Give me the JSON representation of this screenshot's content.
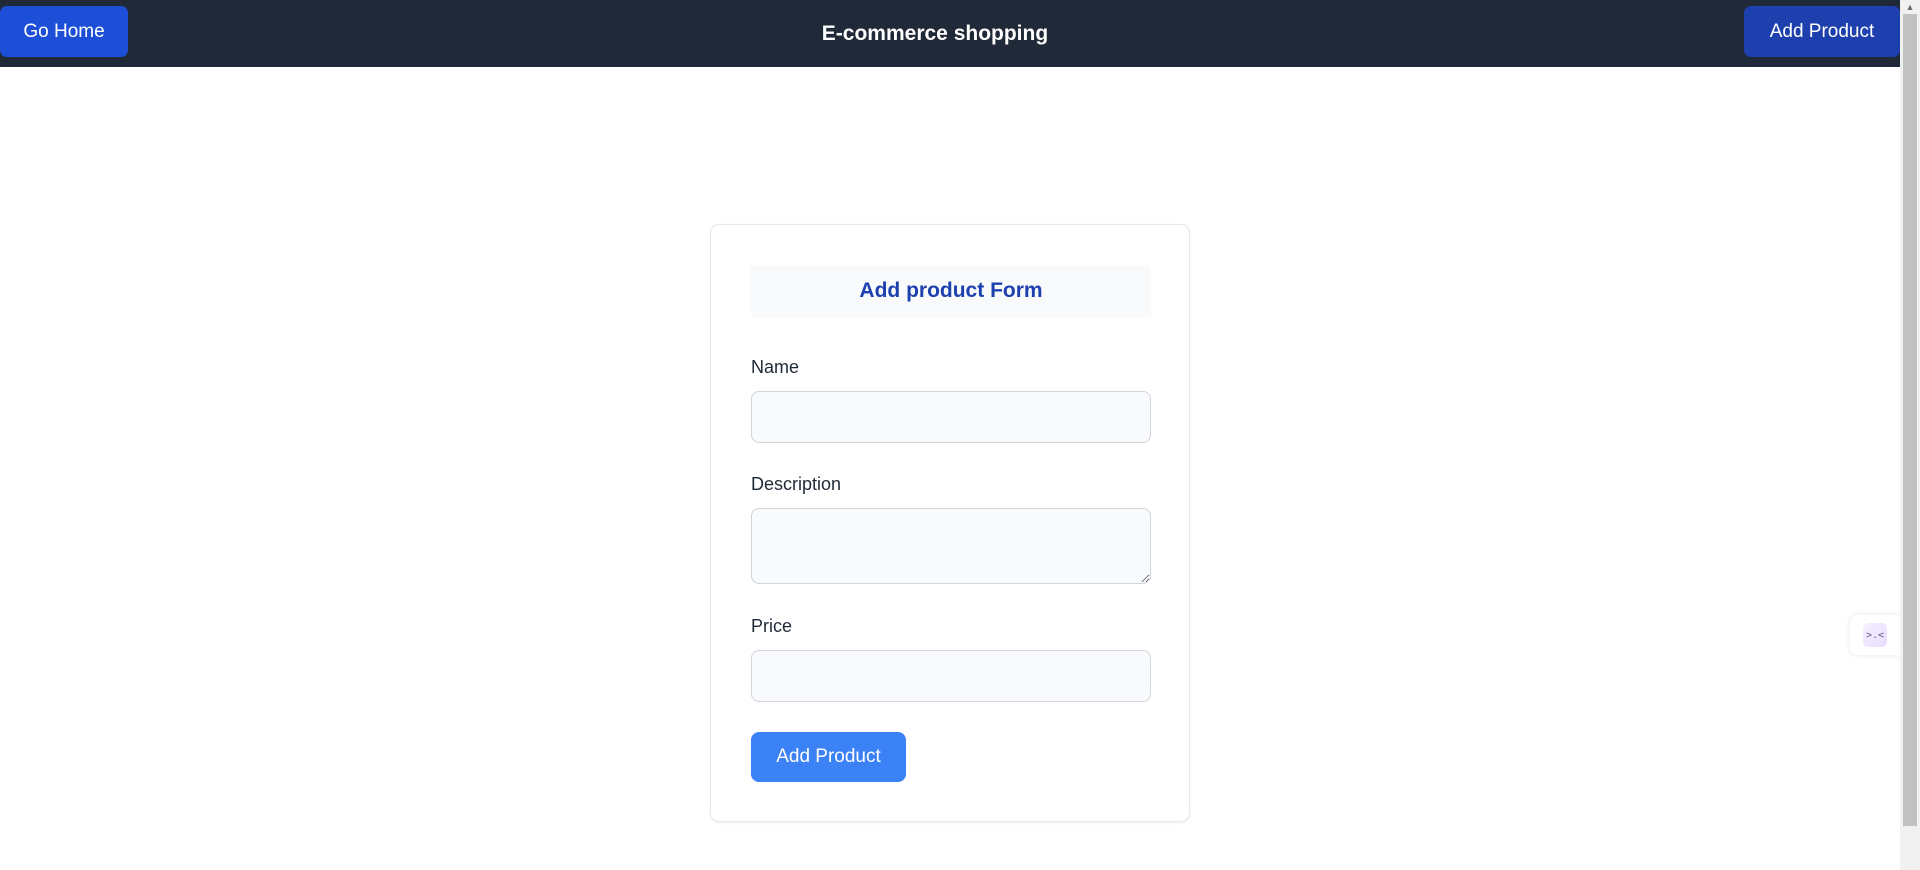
{
  "navbar": {
    "home_label": "Go Home",
    "title": "E-commerce shopping",
    "add_label": "Add Product"
  },
  "form": {
    "heading": "Add product Form",
    "name_label": "Name",
    "name_value": "",
    "description_label": "Description",
    "description_value": "",
    "price_label": "Price",
    "price_value": "",
    "submit_label": "Add Product"
  },
  "widget": {
    "icon": ">.<"
  },
  "colors": {
    "navbar_bg": "#1f2937",
    "home_button": "#1d4ed8",
    "nav_add_button": "#1e40af",
    "form_heading": "#1e40af",
    "submit_button": "#3b82f6"
  }
}
